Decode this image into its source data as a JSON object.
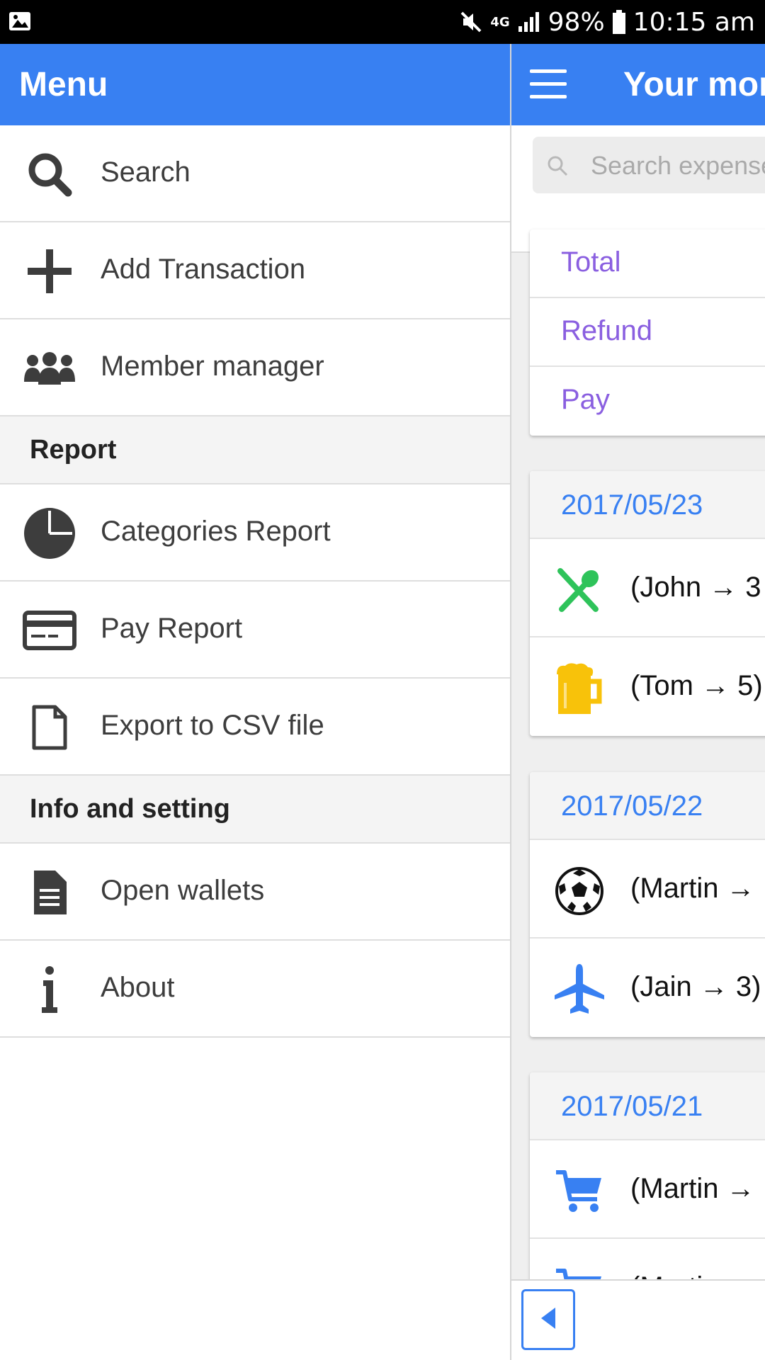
{
  "status_bar": {
    "network": "4G",
    "battery": "98%",
    "time": "10:15 am"
  },
  "drawer": {
    "title": "Menu",
    "items": [
      {
        "label": "Search",
        "icon": "search-icon"
      },
      {
        "label": "Add Transaction",
        "icon": "plus-icon"
      },
      {
        "label": "Member manager",
        "icon": "people-icon"
      }
    ],
    "section_report": "Report",
    "report_items": [
      {
        "label": "Categories Report",
        "icon": "pie-chart-icon"
      },
      {
        "label": "Pay Report",
        "icon": "credit-card-icon"
      },
      {
        "label": "Export to CSV file",
        "icon": "file-icon"
      }
    ],
    "section_info": "Info and setting",
    "info_items": [
      {
        "label": "Open wallets",
        "icon": "document-icon"
      },
      {
        "label": "About",
        "icon": "info-icon"
      }
    ]
  },
  "main": {
    "title": "Your mon",
    "search_placeholder": "Search expense",
    "summary": [
      "Total",
      "Refund",
      "Pay"
    ],
    "days": [
      {
        "date": "2017/05/23",
        "transactions": [
          {
            "text": "(John → 3",
            "icon": "restaurant-icon"
          },
          {
            "text": "(Tom → 5)",
            "icon": "beer-icon"
          }
        ]
      },
      {
        "date": "2017/05/22",
        "transactions": [
          {
            "text": "(Martin →",
            "icon": "soccer-ball-icon"
          },
          {
            "text": "(Jain → 3)",
            "icon": "airplane-icon"
          }
        ]
      },
      {
        "date": "2017/05/21",
        "transactions": [
          {
            "text": "(Martin →",
            "icon": "shopping-cart-icon"
          },
          {
            "text": "(Martin →",
            "icon": "shopping-cart-icon"
          }
        ]
      }
    ]
  },
  "colors": {
    "primary": "#3880f2",
    "summary_text": "#8a5fe0",
    "restaurant": "#2ec35a",
    "beer": "#f8c20a"
  }
}
